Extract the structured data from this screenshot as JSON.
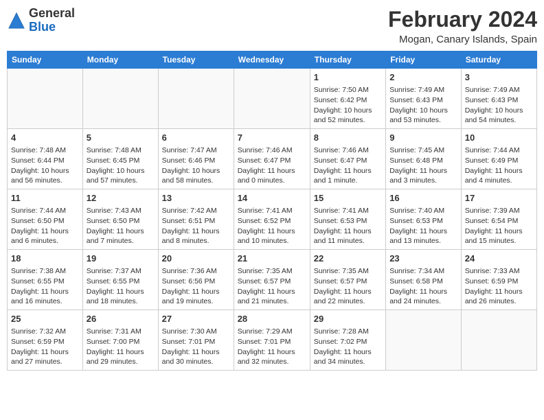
{
  "header": {
    "logo": {
      "general": "General",
      "blue": "Blue"
    },
    "month_year": "February 2024",
    "location": "Mogan, Canary Islands, Spain"
  },
  "days_of_week": [
    "Sunday",
    "Monday",
    "Tuesday",
    "Wednesday",
    "Thursday",
    "Friday",
    "Saturday"
  ],
  "weeks": [
    [
      {
        "day": "",
        "info": ""
      },
      {
        "day": "",
        "info": ""
      },
      {
        "day": "",
        "info": ""
      },
      {
        "day": "",
        "info": ""
      },
      {
        "day": "1",
        "info": "Sunrise: 7:50 AM\nSunset: 6:42 PM\nDaylight: 10 hours\nand 52 minutes."
      },
      {
        "day": "2",
        "info": "Sunrise: 7:49 AM\nSunset: 6:43 PM\nDaylight: 10 hours\nand 53 minutes."
      },
      {
        "day": "3",
        "info": "Sunrise: 7:49 AM\nSunset: 6:43 PM\nDaylight: 10 hours\nand 54 minutes."
      }
    ],
    [
      {
        "day": "4",
        "info": "Sunrise: 7:48 AM\nSunset: 6:44 PM\nDaylight: 10 hours\nand 56 minutes."
      },
      {
        "day": "5",
        "info": "Sunrise: 7:48 AM\nSunset: 6:45 PM\nDaylight: 10 hours\nand 57 minutes."
      },
      {
        "day": "6",
        "info": "Sunrise: 7:47 AM\nSunset: 6:46 PM\nDaylight: 10 hours\nand 58 minutes."
      },
      {
        "day": "7",
        "info": "Sunrise: 7:46 AM\nSunset: 6:47 PM\nDaylight: 11 hours\nand 0 minutes."
      },
      {
        "day": "8",
        "info": "Sunrise: 7:46 AM\nSunset: 6:47 PM\nDaylight: 11 hours\nand 1 minute."
      },
      {
        "day": "9",
        "info": "Sunrise: 7:45 AM\nSunset: 6:48 PM\nDaylight: 11 hours\nand 3 minutes."
      },
      {
        "day": "10",
        "info": "Sunrise: 7:44 AM\nSunset: 6:49 PM\nDaylight: 11 hours\nand 4 minutes."
      }
    ],
    [
      {
        "day": "11",
        "info": "Sunrise: 7:44 AM\nSunset: 6:50 PM\nDaylight: 11 hours\nand 6 minutes."
      },
      {
        "day": "12",
        "info": "Sunrise: 7:43 AM\nSunset: 6:50 PM\nDaylight: 11 hours\nand 7 minutes."
      },
      {
        "day": "13",
        "info": "Sunrise: 7:42 AM\nSunset: 6:51 PM\nDaylight: 11 hours\nand 8 minutes."
      },
      {
        "day": "14",
        "info": "Sunrise: 7:41 AM\nSunset: 6:52 PM\nDaylight: 11 hours\nand 10 minutes."
      },
      {
        "day": "15",
        "info": "Sunrise: 7:41 AM\nSunset: 6:53 PM\nDaylight: 11 hours\nand 11 minutes."
      },
      {
        "day": "16",
        "info": "Sunrise: 7:40 AM\nSunset: 6:53 PM\nDaylight: 11 hours\nand 13 minutes."
      },
      {
        "day": "17",
        "info": "Sunrise: 7:39 AM\nSunset: 6:54 PM\nDaylight: 11 hours\nand 15 minutes."
      }
    ],
    [
      {
        "day": "18",
        "info": "Sunrise: 7:38 AM\nSunset: 6:55 PM\nDaylight: 11 hours\nand 16 minutes."
      },
      {
        "day": "19",
        "info": "Sunrise: 7:37 AM\nSunset: 6:55 PM\nDaylight: 11 hours\nand 18 minutes."
      },
      {
        "day": "20",
        "info": "Sunrise: 7:36 AM\nSunset: 6:56 PM\nDaylight: 11 hours\nand 19 minutes."
      },
      {
        "day": "21",
        "info": "Sunrise: 7:35 AM\nSunset: 6:57 PM\nDaylight: 11 hours\nand 21 minutes."
      },
      {
        "day": "22",
        "info": "Sunrise: 7:35 AM\nSunset: 6:57 PM\nDaylight: 11 hours\nand 22 minutes."
      },
      {
        "day": "23",
        "info": "Sunrise: 7:34 AM\nSunset: 6:58 PM\nDaylight: 11 hours\nand 24 minutes."
      },
      {
        "day": "24",
        "info": "Sunrise: 7:33 AM\nSunset: 6:59 PM\nDaylight: 11 hours\nand 26 minutes."
      }
    ],
    [
      {
        "day": "25",
        "info": "Sunrise: 7:32 AM\nSunset: 6:59 PM\nDaylight: 11 hours\nand 27 minutes."
      },
      {
        "day": "26",
        "info": "Sunrise: 7:31 AM\nSunset: 7:00 PM\nDaylight: 11 hours\nand 29 minutes."
      },
      {
        "day": "27",
        "info": "Sunrise: 7:30 AM\nSunset: 7:01 PM\nDaylight: 11 hours\nand 30 minutes."
      },
      {
        "day": "28",
        "info": "Sunrise: 7:29 AM\nSunset: 7:01 PM\nDaylight: 11 hours\nand 32 minutes."
      },
      {
        "day": "29",
        "info": "Sunrise: 7:28 AM\nSunset: 7:02 PM\nDaylight: 11 hours\nand 34 minutes."
      },
      {
        "day": "",
        "info": ""
      },
      {
        "day": "",
        "info": ""
      }
    ]
  ]
}
